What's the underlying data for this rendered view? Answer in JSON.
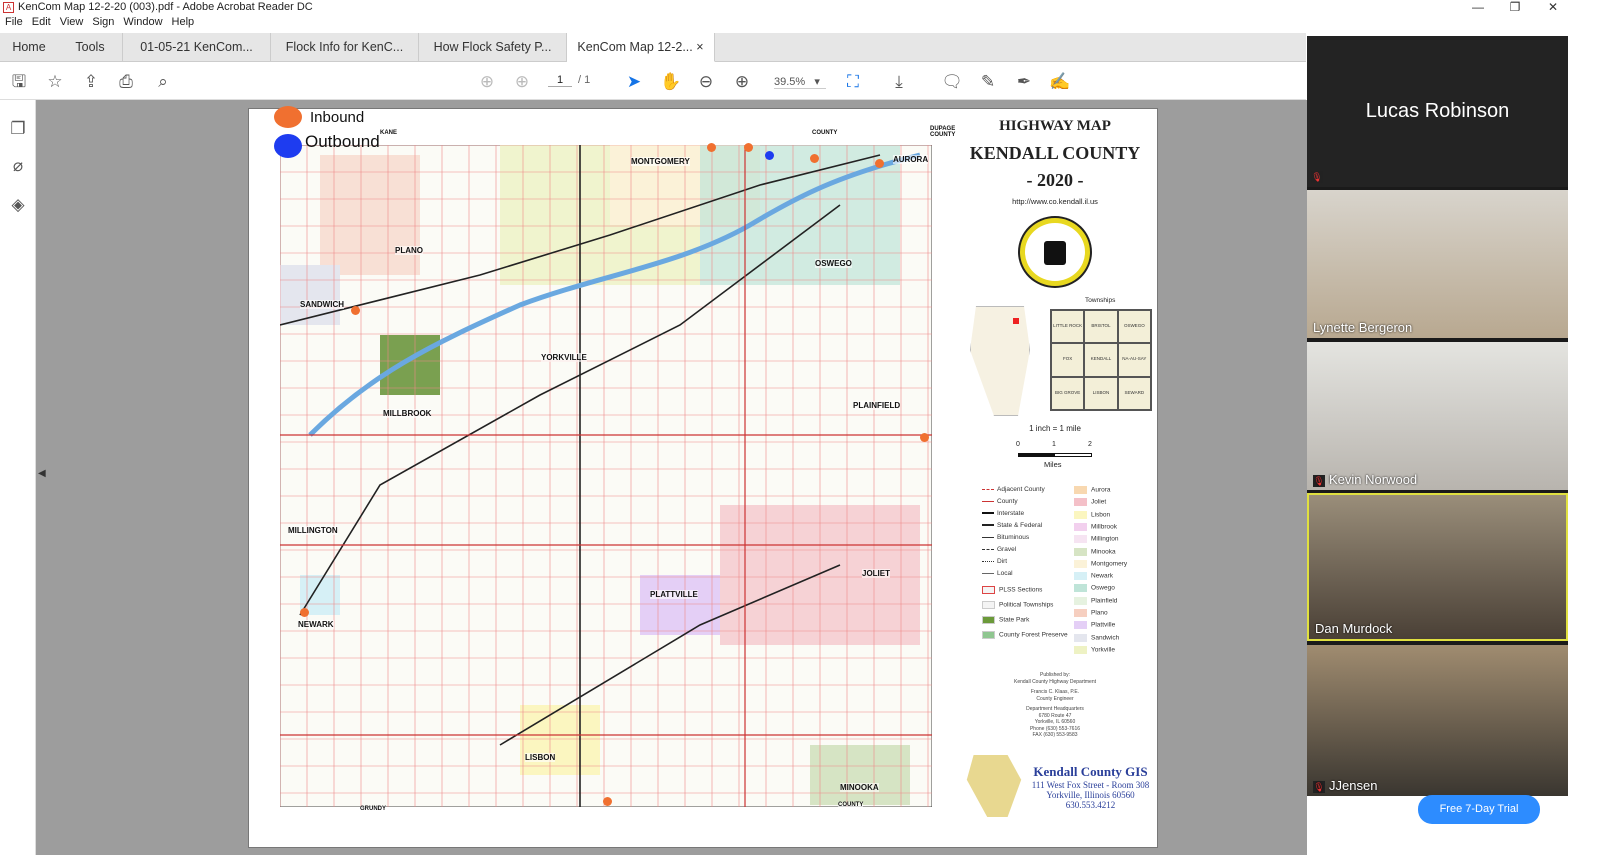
{
  "window": {
    "title": "KenCom Map 12-2-20 (003).pdf - Adobe Acrobat Reader DC",
    "minimize": "—",
    "restore": "❐",
    "close": "✕"
  },
  "menu": [
    "File",
    "Edit",
    "View",
    "Sign",
    "Window",
    "Help"
  ],
  "tabs": [
    {
      "label": "Home"
    },
    {
      "label": "Tools"
    },
    {
      "label": "01-05-21 KenCom..."
    },
    {
      "label": "Flock Info for KenC..."
    },
    {
      "label": "How Flock Safety P..."
    },
    {
      "label": "KenCom Map 12-2...",
      "active": true,
      "close": "×"
    }
  ],
  "toolbar": {
    "page_current": "1",
    "page_total": "/ 1",
    "zoom": "39.5%",
    "zoom_caret": "▾"
  },
  "map": {
    "overlay_legend": {
      "inbound": "Inbound",
      "outbound": "Outbound",
      "inbound_color": "#f07030",
      "outbound_color": "#1e3cf0"
    },
    "title1": "HIGHWAY MAP",
    "title2": "KENDALL COUNTY",
    "year": "- 2020 -",
    "url": "http://www.co.kendall.il.us",
    "seal_text": "KENDALL COUNTY HIGHWAY DEPARTMENT",
    "townships_label": "Townships",
    "townships": [
      "LITTLE ROCK",
      "BRISTOL",
      "OSWEGO",
      "FOX",
      "KENDALL",
      "NA-AU-SAY",
      "BIG GROVE",
      "LISBON",
      "SEWARD"
    ],
    "scale": "1 inch = 1 mile",
    "scale_ticks": [
      "0",
      "1",
      "2"
    ],
    "scale_unit": "Miles",
    "edge_labels": {
      "dupage": "DUPAGE COUNTY",
      "kane": "KANE",
      "county_top": "COUNTY",
      "grundy": "GRUNDY",
      "county_bottom": "COUNTY"
    },
    "towns": [
      "PLANO",
      "SANDWICH",
      "MONTGOMERY",
      "AURORA",
      "OSWEGO",
      "YORKVILLE",
      "MILLBROOK",
      "PLAINFIELD",
      "MILLINGTON",
      "JOLIET",
      "PLATTVILLE",
      "NEWARK",
      "LISBON",
      "MINOOKA"
    ],
    "legend_lines": [
      "Adjacent County",
      "County",
      "Interstate",
      "State & Federal",
      "Bituminous",
      "Gravel",
      "Dirt",
      "Local",
      "PLSS Sections",
      "Political Townships",
      "State Park",
      "County Forest Preserve"
    ],
    "legend_areas": [
      {
        "name": "Aurora",
        "color": "#f8d8b0"
      },
      {
        "name": "Joliet",
        "color": "#f4c0c8"
      },
      {
        "name": "Lisbon",
        "color": "#fbf6c0"
      },
      {
        "name": "Millbrook",
        "color": "#f2d0ee"
      },
      {
        "name": "Millington",
        "color": "#f6e4f2"
      },
      {
        "name": "Minooka",
        "color": "#d6e4c4"
      },
      {
        "name": "Montgomery",
        "color": "#fbf2d8"
      },
      {
        "name": "Newark",
        "color": "#d6f0f6"
      },
      {
        "name": "Oswego",
        "color": "#bfe4d8"
      },
      {
        "name": "Plainfield",
        "color": "#e6f2e0"
      },
      {
        "name": "Plano",
        "color": "#f6cfc0"
      },
      {
        "name": "Plattville",
        "color": "#e4cff6"
      },
      {
        "name": "Sandwich",
        "color": "#e4e6ee"
      },
      {
        "name": "Yorkville",
        "color": "#eef2c4"
      }
    ],
    "published": [
      "Published by:",
      "Kendall County Highway Department",
      "Francis C. Klaas, P.E.",
      "County Engineer",
      "Department Headquarters",
      "6780 Route 47",
      "Yorkville, IL 60560",
      "Phone (630) 553-7616",
      "FAX (630) 553-9583"
    ],
    "gis": {
      "title": "Kendall County GIS",
      "line1": "111 West Fox Street - Room 308",
      "line2": "Yorkville, Illinois 60560",
      "line3": "630.553.4212"
    }
  },
  "video": {
    "participants": [
      {
        "name": "Lucas Robinson",
        "muted": true
      },
      {
        "name": "Lynette Bergeron"
      },
      {
        "name": "Kevin Norwood",
        "muted": true
      },
      {
        "name": "Dan Murdock",
        "active": true
      },
      {
        "name": "JJensen",
        "muted": true
      }
    ],
    "trial_button": "Free 7-Day Trial"
  }
}
